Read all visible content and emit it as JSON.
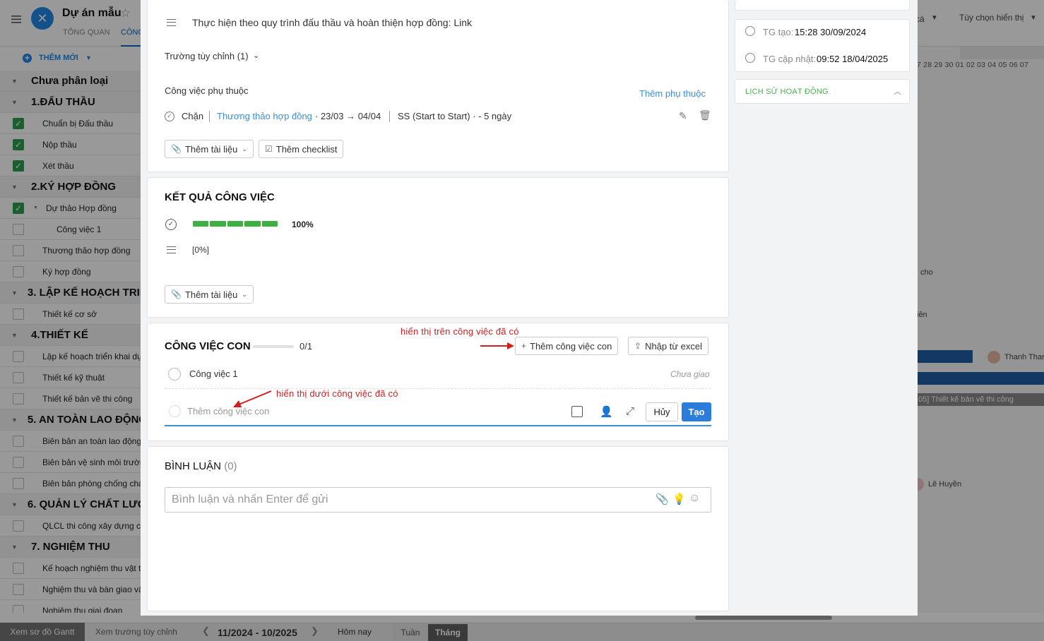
{
  "app": {
    "project_title": "Dự án mẫu",
    "tabs": [
      "TỔNG QUAN",
      "CÔNG"
    ],
    "add_new_label": "THÊM MỚI",
    "sort_text": "cá",
    "view_option_label": "Tùy chọn hiển thị",
    "accent_color": "#1e88e5"
  },
  "task_list": [
    {
      "type": "group",
      "name": "Chưa phân loại"
    },
    {
      "type": "group",
      "name": "1.ĐẤU THẦU"
    },
    {
      "type": "task",
      "name": "Chuẩn bị Đấu thầu",
      "checked": true
    },
    {
      "type": "task",
      "name": "Nộp thầu",
      "checked": true
    },
    {
      "type": "task",
      "name": "Xét thầu",
      "checked": true
    },
    {
      "type": "group",
      "name": "2.KÝ HỢP ĐỒNG"
    },
    {
      "type": "task",
      "name": "Dự thảo Hợp đồng",
      "checked": true,
      "expanded": true
    },
    {
      "type": "subtask",
      "name": "Công việc 1",
      "checked": false
    },
    {
      "type": "task",
      "name": "Thương thảo hợp đồng",
      "checked": false
    },
    {
      "type": "task",
      "name": "Ký hợp đồng",
      "checked": false
    },
    {
      "type": "group",
      "name": "3. LẬP KẾ HOẠCH TRIỂ"
    },
    {
      "type": "task",
      "name": "Thiết kế cơ sở",
      "checked": false
    },
    {
      "type": "group",
      "name": "4.THIẾT KẾ"
    },
    {
      "type": "task",
      "name": "Lập kế hoạch triển khai dự",
      "checked": false
    },
    {
      "type": "task",
      "name": "Thiết kế kỹ thuật",
      "checked": false
    },
    {
      "type": "task",
      "name": "Thiết kế bản vẽ thi công",
      "checked": false
    },
    {
      "type": "group",
      "name": "5. AN TOÀN LAO ĐỘNG"
    },
    {
      "type": "task",
      "name": "Biên bản an toàn lao động",
      "checked": false
    },
    {
      "type": "task",
      "name": "Biên bản vệ sinh môi trườn",
      "checked": false
    },
    {
      "type": "task",
      "name": "Biên bản phòng chống chá",
      "checked": false
    },
    {
      "type": "group",
      "name": "6. QUẢN LÝ CHẤT LƯỢN"
    },
    {
      "type": "task",
      "name": "QLCL thi công xây dựng cô",
      "checked": false
    },
    {
      "type": "group",
      "name": "7. NGHIỆM THU"
    },
    {
      "type": "task",
      "name": "Kế hoạch nghiệm thu vật t",
      "checked": false
    },
    {
      "type": "task",
      "name": "Nghiệm thu và bàn giao vậ",
      "checked": false
    },
    {
      "type": "task",
      "name": "Nghiệm thu giai đoạn",
      "checked": false
    }
  ],
  "gantt": {
    "dates": "7 28 29 30 01 02 03 04 05 06 07",
    "labels": {
      "cho": "cho",
      "ien": "iên",
      "thanh": "Thanh Thar",
      "task_bar": "05] Thiết kế bản vẽ thi công",
      "le_huyen": "Lê Huyền"
    }
  },
  "bottom_bar": {
    "gantt_btn": "Xem sơ đồ Gantt",
    "custom_field_btn": "Xem trường tùy chỉnh",
    "period": "11/2024 - 10/2025",
    "today": "Hôm nay",
    "week": "Tuần",
    "month": "Tháng"
  },
  "detail": {
    "description": "Thực hiện theo quy trình đấu thầu và hoàn thiện hợp đồng: Link",
    "custom_field_toggle": "Trường tùy chỉnh (1)",
    "dependency_title": "Công việc phụ thuộc",
    "add_dependency": "Thêm phụ thuộc",
    "dependency": {
      "type": "Chặn",
      "task": "Thương thảo hợp đồng",
      "dates": "· 23/03 → 04/04",
      "rule": "SS (Start to Start) · - 5 ngày"
    },
    "add_document": "Thêm tài liệu",
    "add_checklist": "Thêm checklist"
  },
  "result": {
    "title": "KẾT QUẢ CÔNG VIỆC",
    "progress_percent": 100,
    "progress_label": "100%",
    "note": "[0%]",
    "add_document": "Thêm tài liệu"
  },
  "subtasks": {
    "title": "CÔNG VIỆC CON",
    "done": 0,
    "count": "0/1",
    "add_button": "Thêm công việc con",
    "import_button": "Nhập từ excel",
    "annotation_top": "hiển thị trên công việc đã có",
    "annotation_bottom": "hiển thị dưới công việc đã có",
    "items": [
      {
        "name": "Công việc 1",
        "assignee": "Chưa giao"
      }
    ],
    "new_placeholder": "Thêm công việc con",
    "cancel": "Hủy",
    "create": "Tạo",
    "annotation_color": "#d21f1f"
  },
  "comments": {
    "title": "BÌNH LUẬN",
    "count": "(0)",
    "placeholder": "Bình luận và nhấn Enter để gửi"
  },
  "meta": {
    "created_label": "TG tạo:",
    "created_value": "15:28 30/09/2024",
    "updated_label": "TG cập nhật:",
    "updated_value": "09:52 18/04/2025",
    "history_title": "LỊCH SỬ HOẠT ĐỘNG"
  }
}
